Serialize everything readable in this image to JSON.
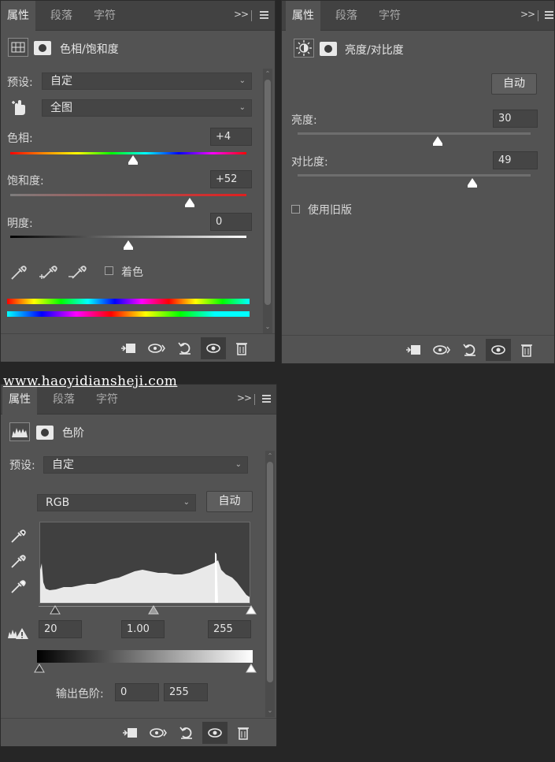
{
  "panels": {
    "hue_sat": {
      "tabs": [
        "属性",
        "段落",
        "字符"
      ],
      "title": "色相/饱和度",
      "preset_label": "预设:",
      "preset_value": "自定",
      "range_value": "全图",
      "hue_label": "色相:",
      "hue_value": "+4",
      "hue_level": 0.52,
      "sat_label": "饱和度:",
      "sat_value": "+52",
      "sat_level": 0.76,
      "light_label": "明度:",
      "light_value": "0",
      "light_level": 0.5,
      "colorize_label": "着色"
    },
    "brightness": {
      "tabs": [
        "属性",
        "段落",
        "字符"
      ],
      "title": "亮度/对比度",
      "auto_label": "自动",
      "brightness_label": "亮度:",
      "brightness_value": "30",
      "brightness_level": 0.6,
      "contrast_label": "对比度:",
      "contrast_value": "49",
      "contrast_level": 0.75,
      "legacy_label": "使用旧版"
    },
    "levels": {
      "tabs": [
        "属性",
        "段落",
        "字符"
      ],
      "title": "色阶",
      "preset_label": "预设:",
      "preset_value": "自定",
      "channel_value": "RGB",
      "auto_label": "自动",
      "input_black": "20",
      "input_gamma": "1.00",
      "input_white": "255",
      "output_label": "输出色阶:",
      "output_black": "0",
      "output_white": "255"
    }
  },
  "watermark": "www.haoyidiansheji.com",
  "icons": {
    "footer": [
      "clip-to-layer-icon",
      "view-previous-icon",
      "reset-icon",
      "visibility-eye-icon",
      "trash-icon"
    ]
  }
}
